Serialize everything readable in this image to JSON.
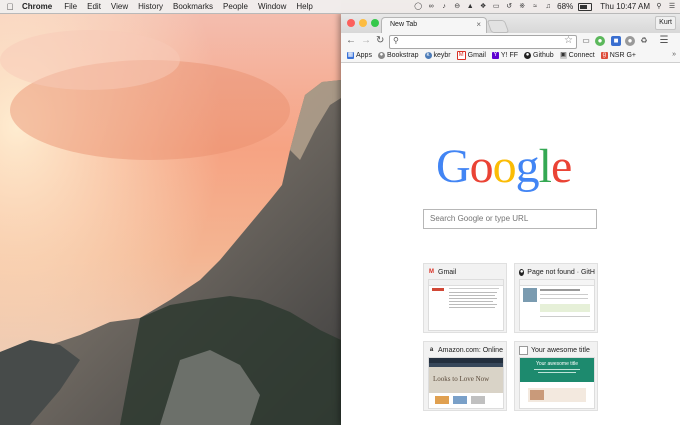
{
  "menubar": {
    "app_name": "Chrome",
    "menus": [
      "File",
      "Edit",
      "View",
      "History",
      "Bookmarks",
      "People",
      "Window",
      "Help"
    ],
    "battery": "68%",
    "clock": "Thu 10:47 AM"
  },
  "browser": {
    "tab_title": "New Tab",
    "tab_close": "×",
    "profile_name": "Kurt",
    "omnibox_value": "",
    "bookmarks": [
      {
        "label": "Apps",
        "icon": "apps-grid-icon"
      },
      {
        "label": "Bookstrap",
        "icon": "bookstrap-icon"
      },
      {
        "label": "keybr",
        "icon": "keybr-icon"
      },
      {
        "label": "Gmail",
        "icon": "gmail-icon"
      },
      {
        "label": "Y! FF",
        "icon": "yahoo-icon"
      },
      {
        "label": "Github",
        "icon": "github-icon"
      },
      {
        "label": "Connect",
        "icon": "connect-icon"
      },
      {
        "label": "NSR G+",
        "icon": "google-plus-icon"
      }
    ],
    "bookmarks_more": "»"
  },
  "page": {
    "logo": "Google",
    "search_placeholder": "Search Google or type URL",
    "tiles": [
      {
        "title": "Gmail",
        "icon": "gmail-icon"
      },
      {
        "title": "Page not found · GitH",
        "icon": "github-icon"
      },
      {
        "title": "Amazon.com: Online",
        "icon": "amazon-icon"
      },
      {
        "title": "Your awesome title",
        "icon": "page-icon"
      }
    ],
    "amazon_thumb_text": "Looks to Love Now",
    "awesome_thumb_heading": "Your awesome title"
  },
  "colors": {
    "google_blue": "#4285f4",
    "google_red": "#ea4335",
    "google_yellow": "#fbbc05",
    "google_green": "#34a853",
    "close_light": "#fc605c",
    "min_light": "#fdbc40",
    "max_light": "#34c84a"
  }
}
